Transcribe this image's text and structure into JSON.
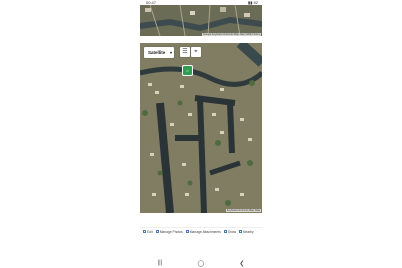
{
  "status_bar": {
    "time": "00:47",
    "icons": "▣ ▲ ●",
    "right": "▮▮ 82"
  },
  "map_top": {
    "attribution": "Google  Keyboard shortcuts  Map data ©2024  Terms"
  },
  "map_controls": {
    "map_type": "Satellite",
    "chevron": "▾",
    "layers_icon": "☰",
    "locate_icon": "⌖",
    "marker": "⌂"
  },
  "map_main": {
    "attribution": "Keyboard shortcuts  Map Data"
  },
  "toolbar": {
    "items": [
      {
        "label": "Edit"
      },
      {
        "label": "Manage Photos"
      },
      {
        "label": "Manage Attachments"
      },
      {
        "label": "Show"
      },
      {
        "label": "Nearby"
      }
    ]
  },
  "nav": {
    "recent": "|||",
    "home": "◯",
    "back": "❮"
  }
}
